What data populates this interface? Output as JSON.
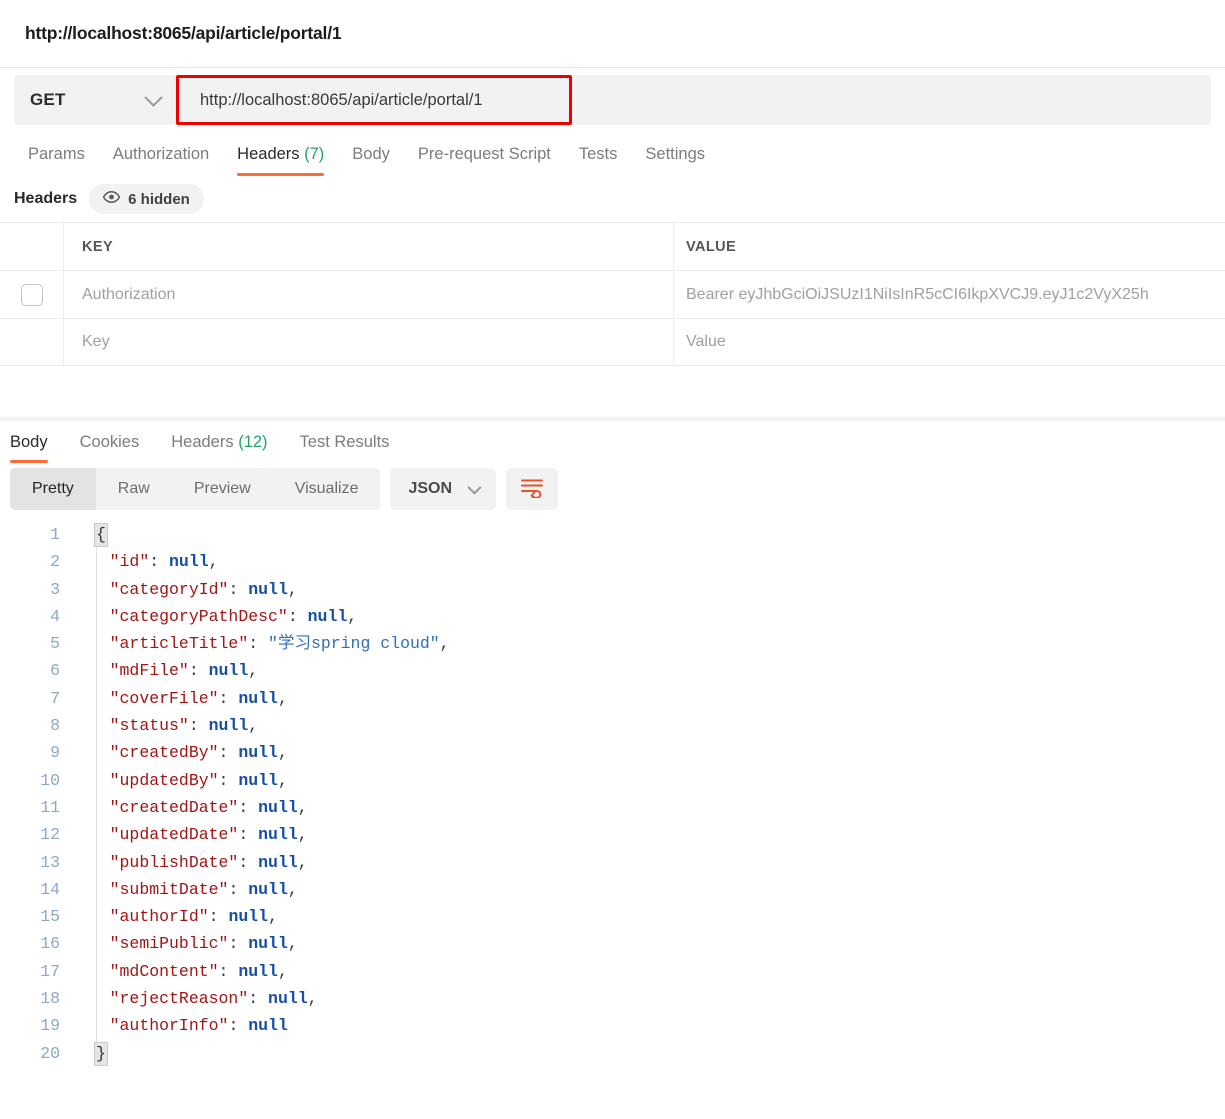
{
  "request": {
    "title": "http://localhost:8065/api/article/portal/1",
    "method": "GET",
    "url": "http://localhost:8065/api/article/portal/1",
    "highlight_color": "#ee0000",
    "accent_color": "#ff6c37",
    "count_color": "#21a366",
    "tabs": [
      {
        "label": "Params",
        "active": false
      },
      {
        "label": "Authorization",
        "active": false
      },
      {
        "label": "Headers",
        "count": "(7)",
        "active": true
      },
      {
        "label": "Body",
        "active": false
      },
      {
        "label": "Pre-request Script",
        "active": false
      },
      {
        "label": "Tests",
        "active": false
      },
      {
        "label": "Settings",
        "active": false
      }
    ]
  },
  "headers_section": {
    "label": "Headers",
    "hidden_badge": "6 hidden",
    "eye_icon": "eye-icon",
    "columns": {
      "key": "KEY",
      "value": "VALUE"
    },
    "rows": [
      {
        "checked": false,
        "key": "Authorization",
        "value": "Bearer eyJhbGciOiJSUzI1NiIsInR5cCI6IkpXVCJ9.eyJ1c2VyX25h"
      },
      {
        "checked": null,
        "key": "Key",
        "value": "Value"
      }
    ]
  },
  "response": {
    "tabs": [
      {
        "label": "Body",
        "active": true
      },
      {
        "label": "Cookies",
        "active": false
      },
      {
        "label": "Headers",
        "count": "(12)",
        "active": false
      },
      {
        "label": "Test Results",
        "active": false
      }
    ],
    "view_modes": [
      {
        "label": "Pretty",
        "active": true
      },
      {
        "label": "Raw",
        "active": false
      },
      {
        "label": "Preview",
        "active": false
      },
      {
        "label": "Visualize",
        "active": false
      }
    ],
    "format": "JSON",
    "wrap_icon": "wrap-text-icon",
    "body_lines": [
      {
        "n": "1",
        "brace": "{"
      },
      {
        "n": "2",
        "key": "\"id\"",
        "value": "null",
        "type": "null",
        "comma": true
      },
      {
        "n": "3",
        "key": "\"categoryId\"",
        "value": "null",
        "type": "null",
        "comma": true
      },
      {
        "n": "4",
        "key": "\"categoryPathDesc\"",
        "value": "null",
        "type": "null",
        "comma": true
      },
      {
        "n": "5",
        "key": "\"articleTitle\"",
        "value": "\"学习spring cloud\"",
        "type": "string",
        "comma": true
      },
      {
        "n": "6",
        "key": "\"mdFile\"",
        "value": "null",
        "type": "null",
        "comma": true
      },
      {
        "n": "7",
        "key": "\"coverFile\"",
        "value": "null",
        "type": "null",
        "comma": true
      },
      {
        "n": "8",
        "key": "\"status\"",
        "value": "null",
        "type": "null",
        "comma": true
      },
      {
        "n": "9",
        "key": "\"createdBy\"",
        "value": "null",
        "type": "null",
        "comma": true
      },
      {
        "n": "10",
        "key": "\"updatedBy\"",
        "value": "null",
        "type": "null",
        "comma": true
      },
      {
        "n": "11",
        "key": "\"createdDate\"",
        "value": "null",
        "type": "null",
        "comma": true
      },
      {
        "n": "12",
        "key": "\"updatedDate\"",
        "value": "null",
        "type": "null",
        "comma": true
      },
      {
        "n": "13",
        "key": "\"publishDate\"",
        "value": "null",
        "type": "null",
        "comma": true
      },
      {
        "n": "14",
        "key": "\"submitDate\"",
        "value": "null",
        "type": "null",
        "comma": true
      },
      {
        "n": "15",
        "key": "\"authorId\"",
        "value": "null",
        "type": "null",
        "comma": true
      },
      {
        "n": "16",
        "key": "\"semiPublic\"",
        "value": "null",
        "type": "null",
        "comma": true
      },
      {
        "n": "17",
        "key": "\"mdContent\"",
        "value": "null",
        "type": "null",
        "comma": true
      },
      {
        "n": "18",
        "key": "\"rejectReason\"",
        "value": "null",
        "type": "null",
        "comma": true
      },
      {
        "n": "19",
        "key": "\"authorInfo\"",
        "value": "null",
        "type": "null",
        "comma": false
      },
      {
        "n": "20",
        "brace": "}"
      }
    ]
  }
}
